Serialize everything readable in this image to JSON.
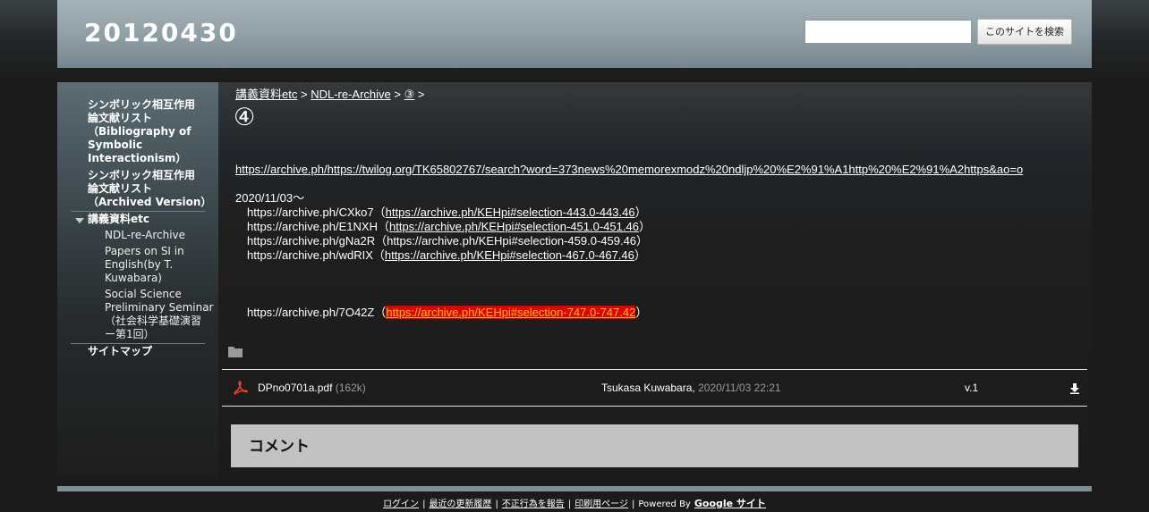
{
  "header": {
    "site_title": "20120430",
    "search_placeholder": "",
    "search_button": "このサイトを検索"
  },
  "sidebar": {
    "items": [
      {
        "label": "シンボリック相互作用論文献リスト（Bibliography of Symbolic Interactionism）"
      },
      {
        "label": "シンボリック相互作用論文献リスト（Archived Version）"
      },
      {
        "label": "講義資料etc",
        "expanded": true,
        "children": [
          {
            "label": "NDL-re-Archive"
          },
          {
            "label": "Papers on SI in English(by T. Kuwabara)"
          },
          {
            "label": "Social Science Preliminary Seminar（社会科学基礎演習ー第1回）"
          }
        ]
      },
      {
        "label": "サイトマップ"
      }
    ],
    "item0_lines": [
      "シンボリック相互作用",
      "論文献リスト",
      "（Bibliography of",
      "Symbolic",
      "Interactionism）"
    ],
    "item1_lines": [
      "シンボリック相互作用",
      "論文献リスト",
      "（Archived Version）"
    ],
    "child1_lines": [
      "Papers on SI in",
      "English(by T.",
      "Kuwabara)"
    ],
    "child2_lines": [
      "Social Science",
      "Preliminary Seminar",
      "（社会科学基礎演習",
      "ー第1回）"
    ]
  },
  "breadcrumb": {
    "items": [
      "講義資料etc",
      "NDL-re-Archive",
      "③"
    ],
    "separator": ">"
  },
  "page_title": "④",
  "main": {
    "top_link": "https://archive.ph/https://twilog.org/TK65802767/search?word=373news%20memorexmodz%20ndljp%20%E2%91%A1http%20%E2%91%A2https&ao=o",
    "date_line": "2020/11/03～",
    "entries": [
      {
        "archive": "https://archive.ph/CXko7",
        "link": "https://archive.ph/KEHpi#selection-443.0-443.46",
        "link_underlined": true
      },
      {
        "archive": "https://archive.ph/E1NXH",
        "link": "https://archive.ph/KEHpi#selection-451.0-451.46",
        "link_underlined": true
      },
      {
        "archive": "https://archive.ph/gNa2R",
        "link": "https://archive.ph/KEHpi#selection-459.0-459.46",
        "link_underlined": false
      },
      {
        "archive": "https://archive.ph/wdRIX",
        "link": "https://archive.ph/KEHpi#selection-467.0-467.46",
        "link_underlined": true
      }
    ],
    "highlight_entry": {
      "archive": "https://archive.ph/7O42Z",
      "link": "https://archive.ph/KEHpi#selection-747.0-747.42"
    },
    "paren_open": "（",
    "paren_close": "）"
  },
  "attachment": {
    "file_name": "DPno0701a.pdf",
    "file_size": "(162k)",
    "author": "Tsukasa Kuwabara,",
    "timestamp": "2020/11/03 22:21",
    "version": "v.1",
    "icons": [
      "folder-icon",
      "pdf-icon",
      "download-icon"
    ]
  },
  "comments": {
    "title": "コメント"
  },
  "footer": {
    "links": [
      "ログイン",
      "最近の更新履歴",
      "不正行為を報告",
      "印刷用ページ"
    ],
    "powered_by": "Powered By",
    "google_sites": "Google サイト"
  },
  "colors": {
    "header_bg": "#8f9ea5",
    "highlight_bg": "#e00000",
    "highlight_text": "#ffc400",
    "comment_bg": "#c2c2c2",
    "footer_bar": "#7d8e96"
  }
}
